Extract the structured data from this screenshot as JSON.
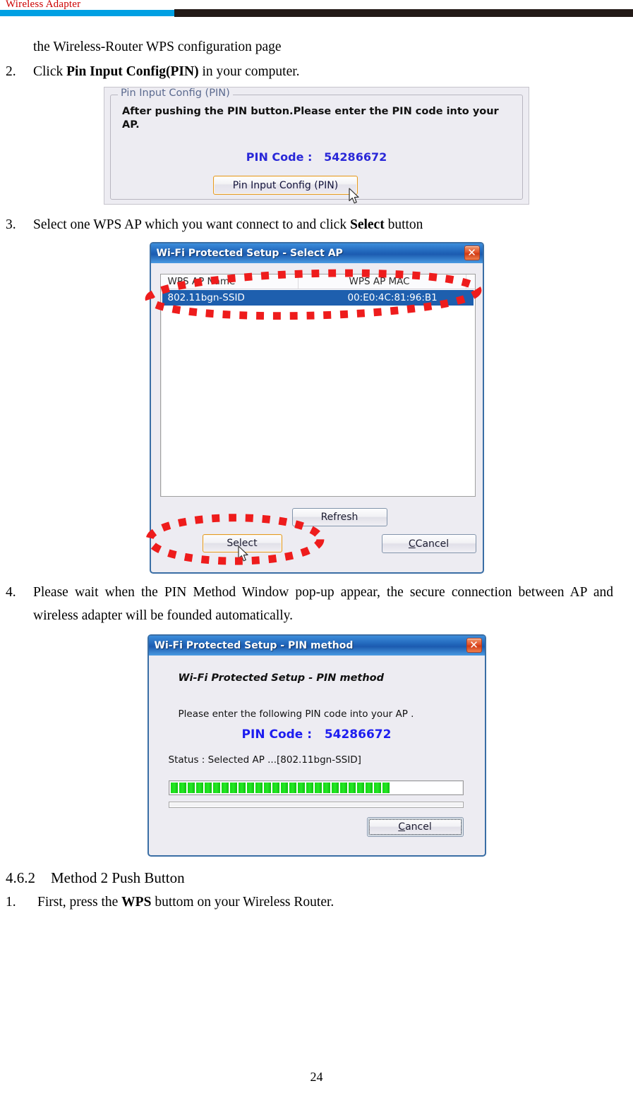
{
  "header": {
    "title": "Wireless Adapter",
    "rule_blue": "#00a0e3",
    "rule_dark": "#231a17",
    "title_color": "#cc0000"
  },
  "body": {
    "line_continuation": "the Wireless-Router WPS configuration page",
    "step2": {
      "number": "2.",
      "before": "Click ",
      "bold": "Pin Input Config(PIN)",
      "after": " in your computer."
    },
    "step3": {
      "number": "3.",
      "before": "Select one WPS AP which you want connect to and click ",
      "bold": "Select",
      "after": " button"
    },
    "step4": {
      "number": "4.",
      "text": "Please wait when the PIN Method Window pop-up appear, the secure connection between AP and wireless adapter will be founded automatically."
    },
    "section": {
      "number": "4.6.2",
      "title": "Method 2 Push Button"
    },
    "step1b": {
      "number": "1.",
      "before": "First, press the ",
      "bold": "WPS",
      "after": " buttom on your Wireless Router."
    }
  },
  "fig_pin_config": {
    "legend": "Pin Input Config (PIN)",
    "description": "After pushing the PIN button.Please enter the PIN code into your AP.",
    "pin_label": "PIN Code :",
    "pin_value": "54286672",
    "pin_color": "#2a28d8",
    "button_label": "Pin Input Config (PIN)",
    "cursor": "mouse-pointer"
  },
  "fig_select_ap": {
    "title": "Wi-Fi Protected Setup - Select AP",
    "close_glyph": "✕",
    "columns": [
      "WPS AP Name",
      "WPS AP MAC"
    ],
    "rows": [
      {
        "name": "802.11bgn-SSID",
        "mac": "00:E0:4C:81:96:B1",
        "selected": true
      }
    ],
    "buttons": {
      "refresh": "Refresh",
      "select": "Select",
      "cancel": "Cancel"
    },
    "annotation_color": "#ee1c1c",
    "selection_color": "#1e5fae",
    "cursor": "mouse-pointer"
  },
  "fig_pin_method": {
    "title": "Wi-Fi Protected Setup - PIN method",
    "close_glyph": "✕",
    "heading": "Wi-Fi Protected Setup - PIN method",
    "subtext": "Please enter the following PIN code into your AP .",
    "pin_label": "PIN Code :",
    "pin_value": "54286672",
    "pin_color": "#1d1df0",
    "status": "Status :  Selected AP ...[802.11bgn-SSID]",
    "progress_segments": 26,
    "progress_total_segments": 44,
    "progress_color": "#16d816",
    "cancel_label_prefix": "C",
    "cancel_label_rest": "ancel"
  },
  "footer": {
    "page_number": "24"
  }
}
